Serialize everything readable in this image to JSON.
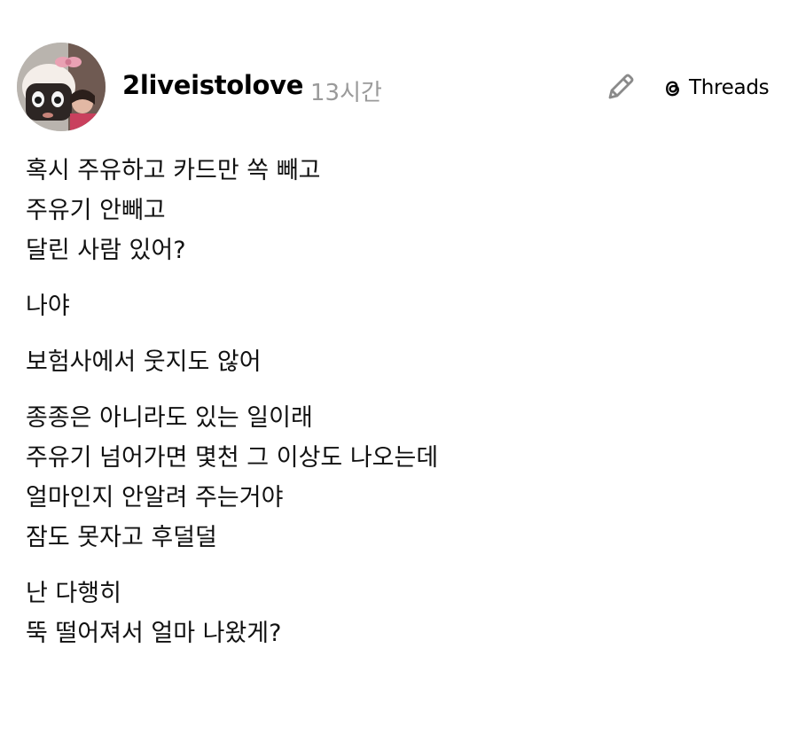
{
  "post": {
    "username": "2liveistolove",
    "time": "13시간",
    "brand": "Threads",
    "paragraphs": [
      [
        "혹시 주유하고 카드만 쏙 빼고",
        "주유기 안빼고",
        "달린 사람 있어?"
      ],
      [
        "나야"
      ],
      [
        "보험사에서 웃지도 않어"
      ],
      [
        "종종은 아니라도 있는 일이래",
        "주유기 넘어가면 몇천 그 이상도 나오는데",
        "얼마인지 안알려 주는거야",
        "잠도 못자고 후덜덜"
      ],
      [
        "난 다행히",
        "뚝 떨어져서 얼마 나왔게?"
      ]
    ]
  },
  "icons": {
    "edit": "pencil-icon",
    "brand": "threads-logo-icon"
  },
  "colors": {
    "username": "#000000",
    "time": "#9a9a9a",
    "body_text": "#111111",
    "icon": "#8a8a8a"
  }
}
